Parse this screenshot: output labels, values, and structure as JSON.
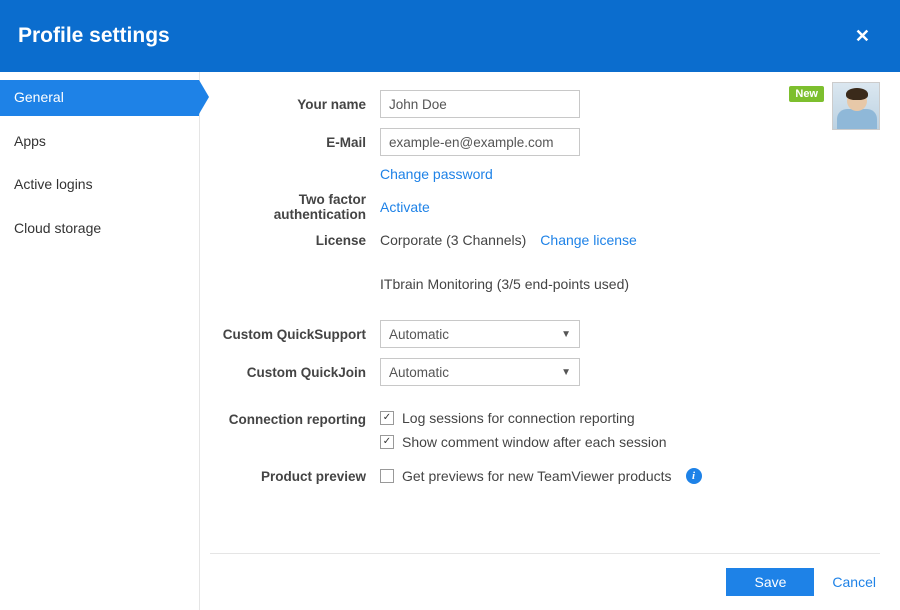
{
  "header": {
    "title": "Profile settings",
    "close": "✕"
  },
  "sidebar": {
    "items": [
      {
        "label": "General",
        "active": true
      },
      {
        "label": "Apps",
        "active": false
      },
      {
        "label": "Active logins",
        "active": false
      },
      {
        "label": "Cloud storage",
        "active": false
      }
    ]
  },
  "topright": {
    "badge": "New"
  },
  "form": {
    "name_label": "Your name",
    "name_value": "John Doe",
    "email_label": "E-Mail",
    "email_value": "example-en@example.com",
    "change_password": "Change password",
    "tfa_label": "Two factor authentication",
    "tfa_link": "Activate",
    "license_label": "License",
    "license_value": "Corporate (3 Channels)",
    "license_link": "Change license",
    "itbrain": "ITbrain Monitoring (3/5 end-points used)",
    "quicksupport_label": "Custom QuickSupport",
    "quicksupport_value": "Automatic",
    "quickjoin_label": "Custom QuickJoin",
    "quickjoin_value": "Automatic",
    "reporting_label": "Connection reporting",
    "reporting_cb1": "Log sessions for connection reporting",
    "reporting_cb2": "Show comment window after each session",
    "preview_label": "Product preview",
    "preview_cb": "Get previews for new TeamViewer products"
  },
  "footer": {
    "save": "Save",
    "cancel": "Cancel"
  }
}
